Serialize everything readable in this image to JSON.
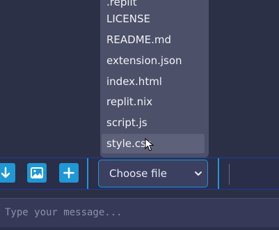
{
  "file_dropdown": {
    "items": [
      ".replit",
      "LICENSE",
      "README.md",
      "extension.json",
      "index.html",
      "replit.nix",
      "script.js",
      "style.css"
    ],
    "hovered_item": "style.css"
  },
  "toolbar": {
    "buttons": [
      {
        "icon": "download-arrow-icon"
      },
      {
        "icon": "image-icon"
      },
      {
        "icon": "plus-icon"
      }
    ],
    "file_select_value": "Choose file",
    "accent_color": "#1e98d6"
  },
  "message": {
    "placeholder": "Type your message...",
    "value": ""
  }
}
